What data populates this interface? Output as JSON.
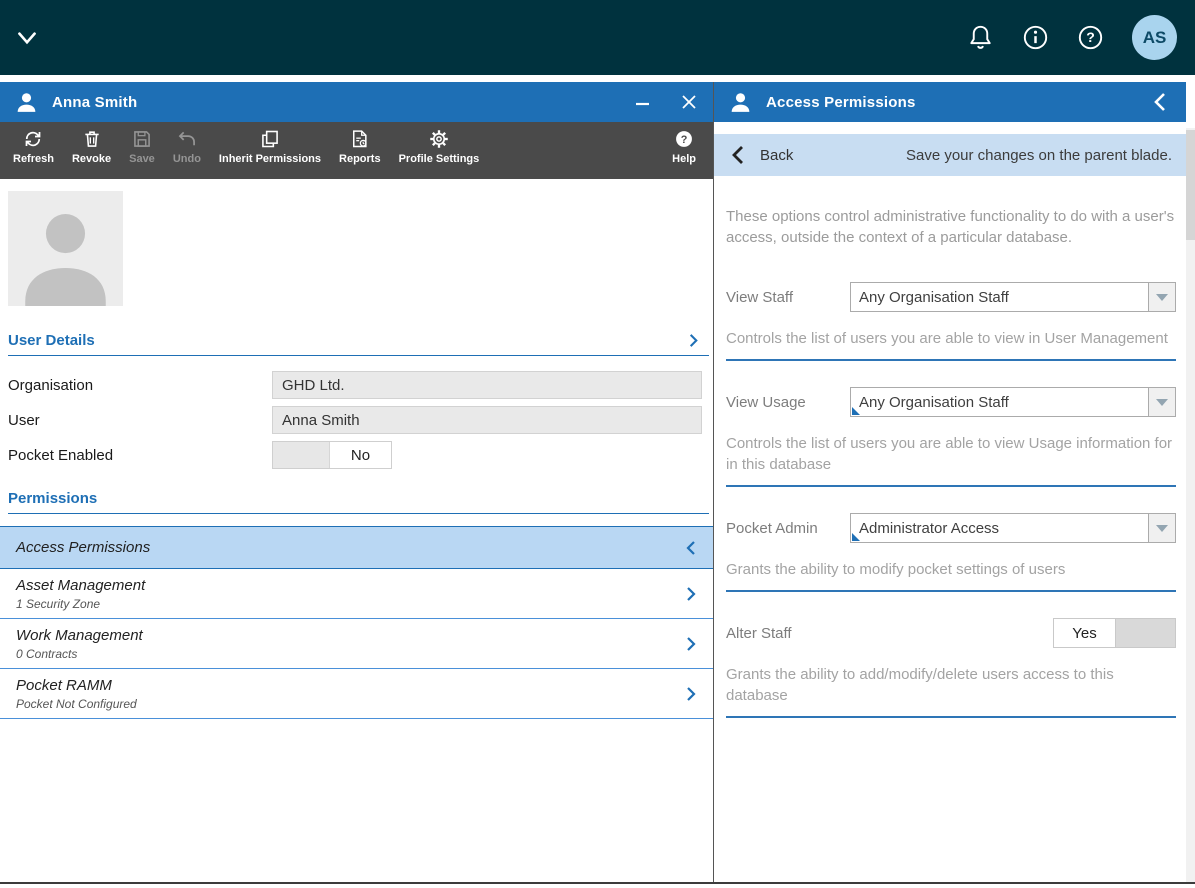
{
  "colors": {
    "topbar_teal": "#00323e",
    "accent_blue": "#1e6fb5",
    "toolbar_gray": "#4a4a4a",
    "selected_item_bg": "#b9d7f3",
    "back_bar_bg": "#c8ddf2"
  },
  "topbar": {
    "avatar_initials": "AS"
  },
  "left_blade": {
    "title": "Anna Smith",
    "toolbar": {
      "buttons": [
        {
          "label": "Refresh",
          "icon": "refresh-icon",
          "enabled": true
        },
        {
          "label": "Revoke",
          "icon": "trash-icon",
          "enabled": true
        },
        {
          "label": "Save",
          "icon": "save-icon",
          "enabled": false
        },
        {
          "label": "Undo",
          "icon": "undo-icon",
          "enabled": false
        },
        {
          "label": "Inherit Permissions",
          "icon": "copy-icon",
          "enabled": true
        },
        {
          "label": "Reports",
          "icon": "report-icon",
          "enabled": true
        },
        {
          "label": "Profile Settings",
          "icon": "gear-icon",
          "enabled": true
        }
      ],
      "help": {
        "label": "Help",
        "icon": "help-icon"
      }
    },
    "user_details": {
      "section_title": "User Details",
      "fields": [
        {
          "label": "Organisation",
          "value": "GHD Ltd."
        },
        {
          "label": "User",
          "value": "Anna Smith"
        },
        {
          "label": "Pocket Enabled",
          "value": "No"
        }
      ]
    },
    "permissions": {
      "section_title": "Permissions",
      "items": [
        {
          "title": "Access Permissions",
          "subtitle": "",
          "selected": true
        },
        {
          "title": "Asset Management",
          "subtitle": "1 Security Zone",
          "selected": false
        },
        {
          "title": "Work Management",
          "subtitle": "0 Contracts",
          "selected": false
        },
        {
          "title": "Pocket RAMM",
          "subtitle": "Pocket Not Configured",
          "selected": false
        }
      ]
    }
  },
  "right_blade": {
    "title": "Access Permissions",
    "back_bar": {
      "back_label": "Back",
      "message": "Save your changes on the parent blade."
    },
    "intro": "These options control administrative functionality to do with a user's access, outside the context of a particular database.",
    "fields": [
      {
        "label": "View Staff",
        "control": "dropdown",
        "value": "Any Organisation Staff",
        "modified": false,
        "help": "Controls the list of users you are able to view in User Management"
      },
      {
        "label": "View Usage",
        "control": "dropdown",
        "value": "Any Organisation Staff",
        "modified": true,
        "help": "Controls the list of users you are able to view Usage information for in this database"
      },
      {
        "label": "Pocket Admin",
        "control": "dropdown",
        "value": "Administrator Access",
        "modified": true,
        "help": "Grants the ability to modify pocket settings of users"
      },
      {
        "label": "Alter Staff",
        "control": "toggle",
        "value": "Yes",
        "modified": false,
        "help": "Grants the ability to add/modify/delete users access to this database"
      }
    ]
  }
}
